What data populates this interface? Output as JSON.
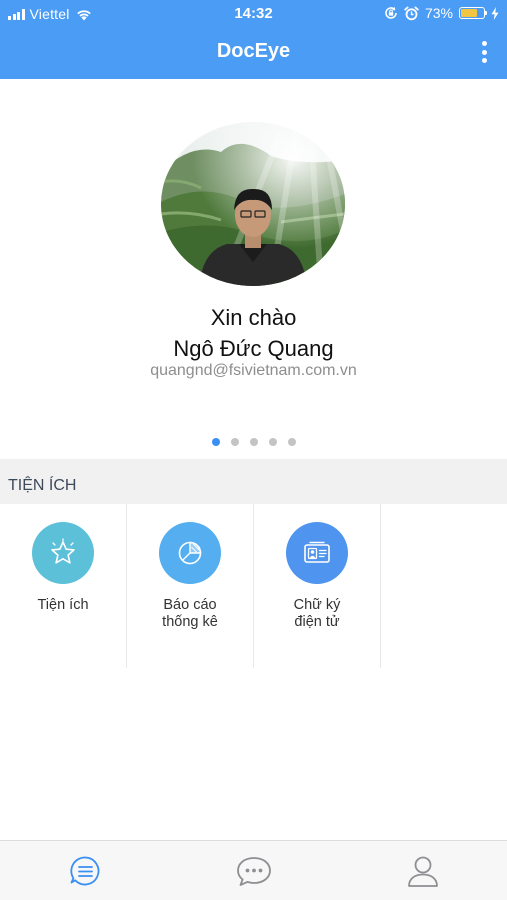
{
  "status_bar": {
    "carrier": "Viettel",
    "time": "14:32",
    "battery_percent": "73%",
    "battery_level": 0.73,
    "icons": [
      "signal-icon",
      "wifi-icon",
      "orientation-lock-icon",
      "alarm-icon",
      "battery-icon",
      "charging-icon"
    ]
  },
  "nav": {
    "title": "DocEye",
    "menu_icon": "more-vertical-icon"
  },
  "profile": {
    "greeting": "Xin chào",
    "name": "Ngô Đức Quang",
    "email": "quangnd@fsivietnam.com.vn",
    "pager": {
      "count": 5,
      "active_index": 0
    }
  },
  "section": {
    "title": "TIỆN ÍCH"
  },
  "tiles": [
    {
      "label": "Tiện ích",
      "icon": "star-icon",
      "color": "#5bc0d8"
    },
    {
      "label": "Báo cáo\nthống kê",
      "icon": "pie-chart-icon",
      "color": "#55aef0"
    },
    {
      "label": "Chữ ký\nđiện tử",
      "icon": "id-card-icon",
      "color": "#4f94ee"
    }
  ],
  "tab_bar": {
    "items": [
      {
        "icon": "list-icon",
        "active": true
      },
      {
        "icon": "chat-icon",
        "active": false
      },
      {
        "icon": "user-icon",
        "active": false
      }
    ],
    "active_color": "#3a8ff2",
    "inactive_color": "#8e8e93"
  },
  "colors": {
    "header": "#4a9cf5",
    "section_bg": "#f1f1f1"
  }
}
